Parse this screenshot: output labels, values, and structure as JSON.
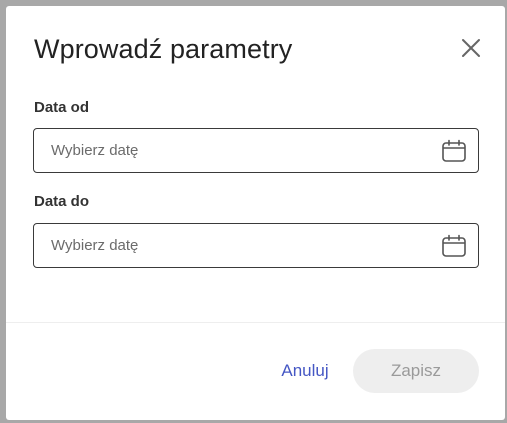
{
  "dialog": {
    "title": "Wprowadź parametry",
    "close_icon": "close-icon"
  },
  "fields": [
    {
      "label": "Data od",
      "placeholder": "Wybierz datę",
      "value": "",
      "icon": "calendar-icon"
    },
    {
      "label": "Data do",
      "placeholder": "Wybierz datę",
      "value": "",
      "icon": "calendar-icon"
    }
  ],
  "actions": {
    "cancel_label": "Anuluj",
    "save_label": "Zapisz",
    "save_enabled": false
  },
  "colors": {
    "accent": "#4557c4",
    "disabled_button_bg": "#eeeeee",
    "disabled_button_text": "#9a9a9a"
  }
}
